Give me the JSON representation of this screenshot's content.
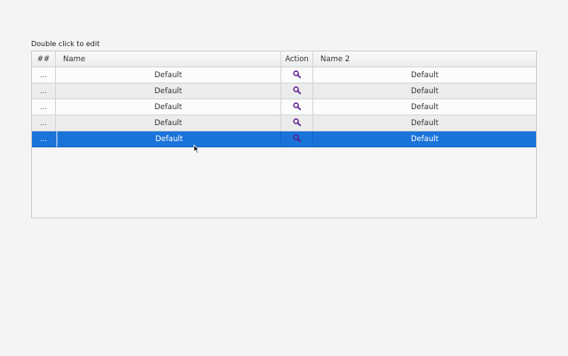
{
  "hint": "Double click to edit",
  "header": {
    "col0": "##",
    "col1": "Name",
    "col2": "Action",
    "col3": "Name 2"
  },
  "rows": [
    {
      "index": "...",
      "name": "Default",
      "name2": "Default"
    },
    {
      "index": "...",
      "name": "Default",
      "name2": "Default"
    },
    {
      "index": "...",
      "name": "Default",
      "name2": "Default"
    },
    {
      "index": "...",
      "name": "Default",
      "name2": "Default"
    },
    {
      "index": "...",
      "name": "Default",
      "name2": "Default"
    }
  ],
  "selected_row": 4,
  "icons": {
    "action": "search-icon"
  },
  "colors": {
    "selection": "#1a73d9",
    "action_icon": "#5b1a8f"
  }
}
